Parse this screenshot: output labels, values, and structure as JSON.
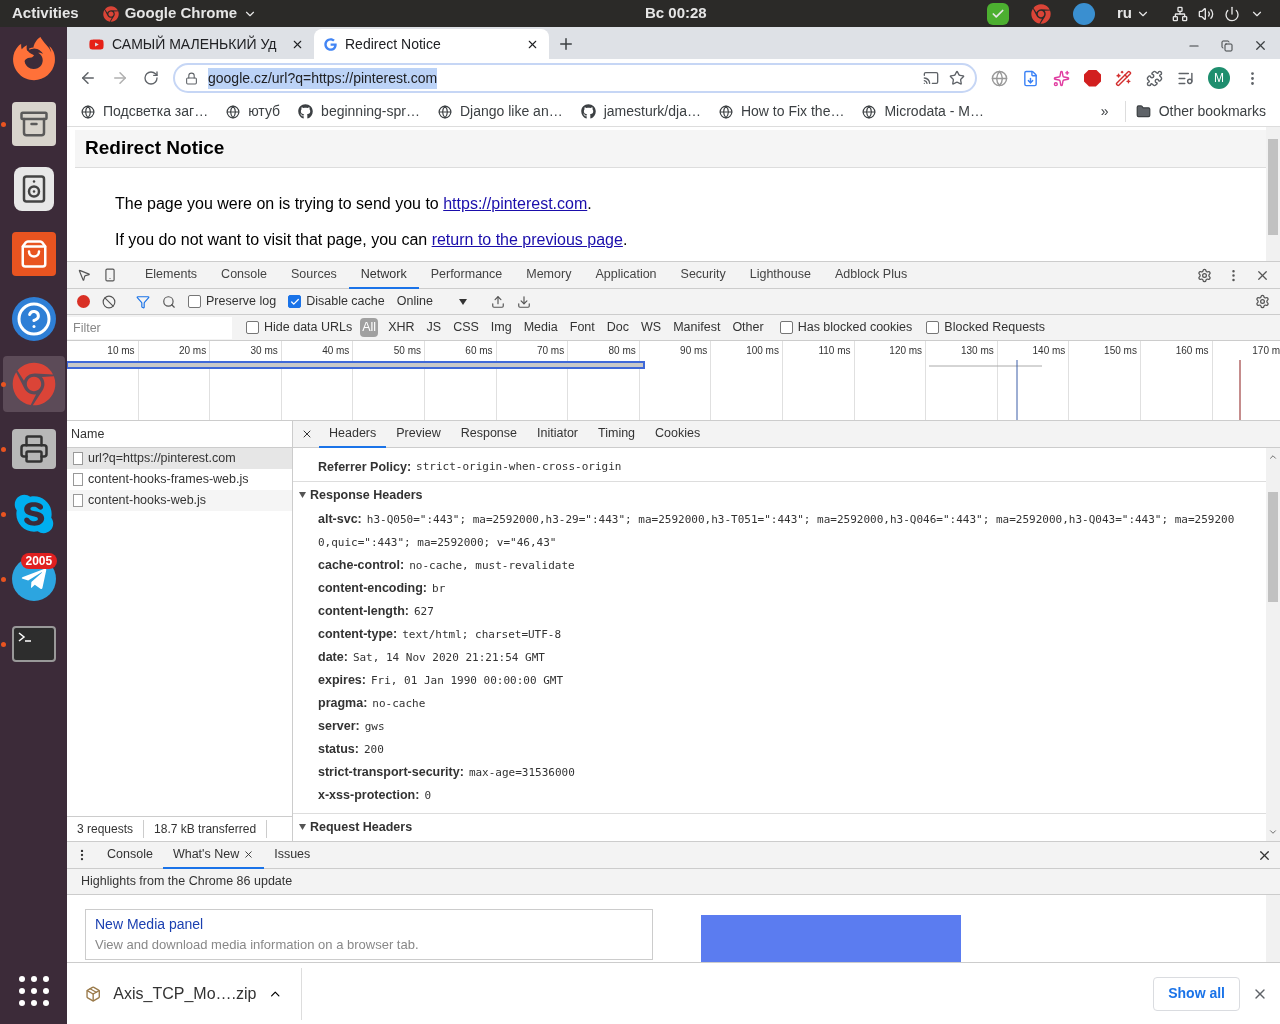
{
  "system_bar": {
    "activities": "Activities",
    "app_name": "Google Chrome",
    "clock": "Вс 00:28",
    "keyboard_layout": "ru"
  },
  "dock": {
    "items": [
      {
        "kind": "firefox",
        "running": false,
        "selected": false
      },
      {
        "kind": "files",
        "running": true,
        "selected": false
      },
      {
        "kind": "speaker",
        "running": false,
        "selected": false
      },
      {
        "kind": "store",
        "running": false,
        "selected": false
      },
      {
        "kind": "help",
        "running": false,
        "selected": false
      },
      {
        "kind": "chrome",
        "running": true,
        "selected": true
      },
      {
        "kind": "scanner",
        "running": true,
        "selected": false
      },
      {
        "kind": "skype",
        "running": true,
        "selected": false
      },
      {
        "kind": "telegram",
        "running": true,
        "selected": false,
        "badge": "2005"
      },
      {
        "kind": "terminal",
        "running": true,
        "selected": false
      }
    ]
  },
  "browser_tabs": [
    {
      "title": "САМЫЙ МАЛЕНЬКИЙ Уд",
      "kind": "video",
      "selected": false
    },
    {
      "title": "Redirect Notice",
      "kind": "google",
      "selected": true
    }
  ],
  "address_bar": {
    "url": "google.cz/url?q=https://pinterest.com",
    "selected": true
  },
  "profile": {
    "initial": "M"
  },
  "bookmarks": [
    {
      "label": "Подсветка заг…",
      "kind": "site"
    },
    {
      "label": "ютуб",
      "kind": "site"
    },
    {
      "label": "beginning-spr…",
      "kind": "repo"
    },
    {
      "label": "Django like an…",
      "kind": "site"
    },
    {
      "label": "jamesturk/dja…",
      "kind": "repo"
    },
    {
      "label": "How to Fix the…",
      "kind": "site"
    },
    {
      "label": "Microdata - M…",
      "kind": "site"
    }
  ],
  "overflow": "»",
  "other_bookmarks": "Other bookmarks",
  "page": {
    "title": "Redirect Notice",
    "paragraphs": [
      {
        "before": "The page you were on is trying to send you to ",
        "link": "https://pinterest.com",
        "after": "."
      },
      {
        "before": "If you do not want to visit that page, you can ",
        "link": "return to the previous page",
        "after": "."
      }
    ]
  },
  "devtools": {
    "panels": [
      {
        "label": "Elements",
        "selected": false
      },
      {
        "label": "Console",
        "selected": false
      },
      {
        "label": "Sources",
        "selected": false
      },
      {
        "label": "Network",
        "selected": true
      },
      {
        "label": "Performance",
        "selected": false
      },
      {
        "label": "Memory",
        "selected": false
      },
      {
        "label": "Application",
        "selected": false
      },
      {
        "label": "Security",
        "selected": false
      },
      {
        "label": "Lighthouse",
        "selected": false
      },
      {
        "label": "Adblock Plus",
        "selected": false
      }
    ],
    "recording": true,
    "preserve_log": {
      "label": "Preserve log",
      "checked": false
    },
    "disable_cache": {
      "label": "Disable cache",
      "checked": true
    },
    "throttling": "Online",
    "filter": {
      "placeholder": "Filter"
    },
    "hide_data_urls": {
      "label": "Hide data URLs",
      "checked": false
    },
    "types": [
      {
        "label": "All",
        "selected": true
      },
      {
        "label": "XHR",
        "selected": false
      },
      {
        "label": "JS",
        "selected": false
      },
      {
        "label": "CSS",
        "selected": false
      },
      {
        "label": "Img",
        "selected": false
      },
      {
        "label": "Media",
        "selected": false
      },
      {
        "label": "Font",
        "selected": false
      },
      {
        "label": "Doc",
        "selected": false
      },
      {
        "label": "WS",
        "selected": false
      },
      {
        "label": "Manifest",
        "selected": false
      },
      {
        "label": "Other",
        "selected": false
      }
    ],
    "has_blocked_cookies": {
      "label": "Has blocked cookies",
      "checked": false
    },
    "blocked_requests": {
      "label": "Blocked Requests",
      "checked": false
    },
    "timeline_ticks": [
      "10 ms",
      "20 ms",
      "30 ms",
      "40 ms",
      "50 ms",
      "60 ms",
      "70 ms",
      "80 ms",
      "90 ms",
      "100 ms",
      "110 ms",
      "120 ms",
      "130 ms",
      "140 ms",
      "150 ms",
      "160 ms",
      "170 m"
    ],
    "name_column": "Name",
    "requests": [
      {
        "name": "url?q=https://pinterest.com",
        "selected": true
      },
      {
        "name": "content-hooks-frames-web.js",
        "selected": false
      },
      {
        "name": "content-hooks-web.js",
        "selected": false
      }
    ],
    "summary": [
      "3 requests",
      "18.7 kB transferred"
    ],
    "detail_tabs": [
      {
        "label": "Headers",
        "selected": true
      },
      {
        "label": "Preview",
        "selected": false
      },
      {
        "label": "Response",
        "selected": false
      },
      {
        "label": "Initiator",
        "selected": false
      },
      {
        "label": "Timing",
        "selected": false
      },
      {
        "label": "Cookies",
        "selected": false
      }
    ],
    "general_rows": [
      {
        "name": "Referrer Policy:",
        "value": "strict-origin-when-cross-origin"
      }
    ],
    "sections": [
      {
        "title": "Response Headers",
        "expanded": true,
        "rows": [
          {
            "name": "alt-svc:",
            "value": "h3-Q050=\":443\"; ma=2592000,h3-29=\":443\"; ma=2592000,h3-T051=\":443\"; ma=2592000,h3-Q046=\":443\"; ma=2592000,h3-Q043=\":443\"; ma=2592000,quic=\":443\"; ma=2592000; v=\"46,43\""
          },
          {
            "name": "cache-control:",
            "value": "no-cache, must-revalidate"
          },
          {
            "name": "content-encoding:",
            "value": "br"
          },
          {
            "name": "content-length:",
            "value": "627"
          },
          {
            "name": "content-type:",
            "value": "text/html; charset=UTF-8"
          },
          {
            "name": "date:",
            "value": "Sat, 14 Nov 2020 21:21:54 GMT"
          },
          {
            "name": "expires:",
            "value": "Fri, 01 Jan 1990 00:00:00 GMT"
          },
          {
            "name": "pragma:",
            "value": "no-cache"
          },
          {
            "name": "server:",
            "value": "gws"
          },
          {
            "name": "status:",
            "value": "200"
          },
          {
            "name": "strict-transport-security:",
            "value": "max-age=31536000"
          },
          {
            "name": "x-xss-protection:",
            "value": "0"
          }
        ]
      },
      {
        "title": "Request Headers",
        "expanded": true
      }
    ],
    "drawer_tabs": [
      {
        "label": "Console",
        "selected": false
      },
      {
        "label": "What's New",
        "selected": true
      },
      {
        "label": "Issues",
        "selected": false
      }
    ],
    "highlights": "Highlights from the Chrome 86 update",
    "feature": {
      "title": "New Media panel",
      "description": "View and download media information on a browser tab."
    }
  },
  "download": {
    "file": "Axis_TCP_Mo….zip",
    "show_all": "Show all"
  }
}
